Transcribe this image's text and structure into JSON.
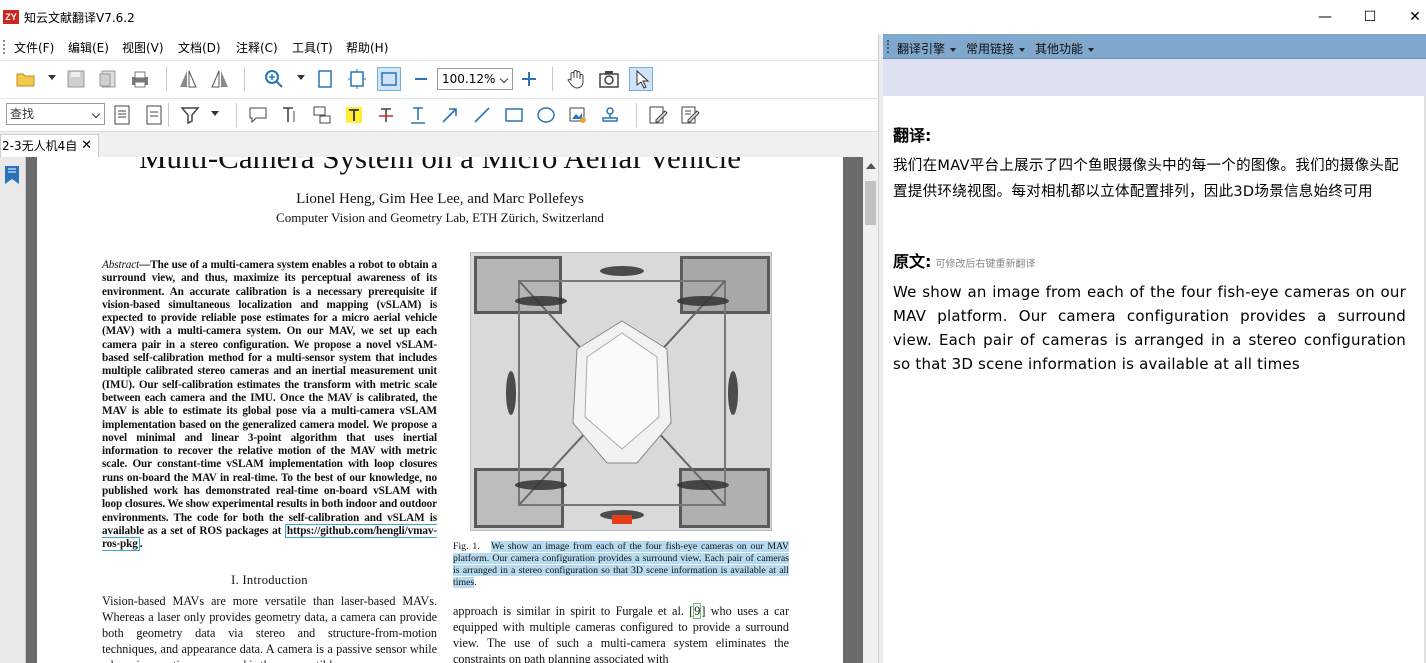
{
  "window": {
    "title": "知云文献翻译V7.6.2",
    "logo_text": "ZY"
  },
  "menu": [
    "文件(F)",
    "编辑(E)",
    "视图(V)",
    "文档(D)",
    "注释(C)",
    "工具(T)",
    "帮助(H)"
  ],
  "toolbar": {
    "zoom_value": "100.12%",
    "search_placeholder": "查找"
  },
  "tab": {
    "label": "2-3无人机4自",
    "close": "✕"
  },
  "pdf": {
    "title": "Multi-Camera System on a Micro Aerial Vehicle",
    "authors": "Lionel Heng, Gim Hee Lee, and Marc Pollefeys",
    "affiliation": "Computer Vision and Geometry Lab, ETH Zürich, Switzerland",
    "abstract_label": "Abstract",
    "abstract": "—The use of a multi-camera system enables a robot to obtain a surround view, and thus, maximize its perceptual awareness of its environment. An accurate calibration is a necessary prerequisite if vision-based simultaneous localization and mapping (vSLAM) is expected to provide reliable pose estimates for a micro aerial vehicle (MAV) with a multi-camera system. On our MAV, we set up each camera pair in a stereo configuration. We propose a novel vSLAM-based self-calibration method for a multi-sensor system that includes multiple calibrated stereo cameras and an inertial measurement unit (IMU). Our self-calibration estimates the transform with metric scale between each camera and the IMU. Once the MAV is calibrated, the MAV is able to estimate its global pose via a multi-camera vSLAM implementation based on the generalized camera model. We propose a novel minimal and linear 3-point algorithm that uses inertial information to recover the relative motion of the MAV with metric scale. Our constant-time vSLAM implementation with loop closures runs on-board the MAV in real-time. To the best of our knowledge, no published work has demonstrated real-time on-board vSLAM with loop closures. We show experimental results in both indoor and outdoor environments. The code for both the self-calibration and vSLAM is available as a set of ROS packages at ",
    "link": "https://github.com/hengli/vmav-ros-pkg",
    "section": "I. Introduction",
    "intro": "Vision-based MAVs are more versatile than laser-based MAVs. Whereas a laser only provides geometry data, a camera can provide both geometry data via stereo and structure-from-motion techniques, and appearance data. A camera is a passive sensor while a laser is an active sensor and is thus susceptible",
    "fig_label": "Fig. 1.",
    "fig_caption": "We show an image from each of the four fish-eye cameras on our MAV platform. Our camera configuration provides a surround view. Each pair of cameras is arranged in a stereo configuration so that 3D scene information is available at all times",
    "right_before": "approach is similar in spirit to Furgale et al. [",
    "right_ref": "9",
    "right_after": "] who uses a car equipped with multiple cameras configured to provide a surround view. The use of such a multi-camera system eliminates the constraints on path planning associated with"
  },
  "panel": {
    "menu": [
      "翻译引擎",
      "常用链接",
      "其他功能"
    ],
    "translation_heading": "翻译:",
    "translation": "我们在MAV平台上展示了四个鱼眼摄像头中的每一个的图像。我们的摄像头配置提供环绕视图。每对相机都以立体配置排列，因此3D场景信息始终可用",
    "original_heading": "原文:",
    "original_hint": "可修改后右键重新翻译",
    "original": "We show an image from each of the four fish-eye cameras on our MAV platform. Our camera configuration provides a surround view. Each pair of cameras is arranged in a stereo configuration so that 3D scene information is available at all times"
  }
}
